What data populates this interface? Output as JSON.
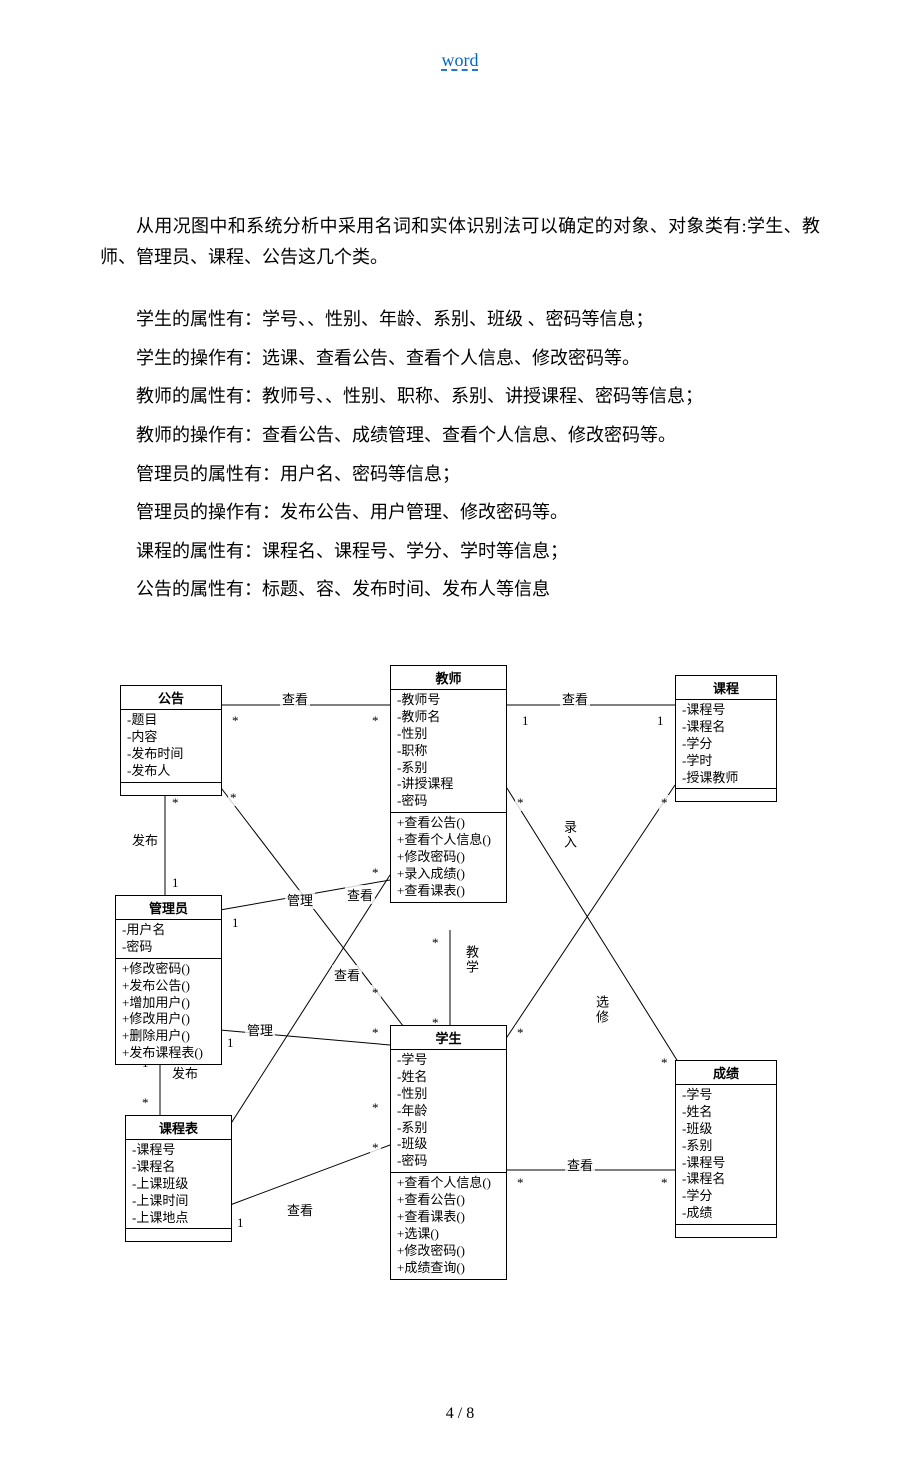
{
  "header": {
    "word_label": "word"
  },
  "paragraphs": {
    "intro": "从用况图中和系统分析中采用名词和实体识别法可以确定的对象、对象类有:学生、教师、管理员、课程、公告这几个类。",
    "lines": [
      "学生的属性有：学号、、性别、年龄、系别、班级 、密码等信息；",
      "学生的操作有：选课、查看公告、查看个人信息、修改密码等。",
      "教师的属性有：教师号、、性别、职称、系别、讲授课程、密码等信息；",
      "教师的操作有：查看公告、成绩管理、查看个人信息、修改密码等。",
      "管理员的属性有：用户名、密码等信息；",
      "管理员的操作有：发布公告、用户管理、修改密码等。",
      "课程的属性有：课程名、课程号、学分、学时等信息；",
      "公告的属性有：标题、容、发布时间、发布人等信息"
    ]
  },
  "diagram": {
    "boxes": {
      "gonggao": {
        "title": "公告",
        "attrs": [
          "-题目",
          "-内容",
          "-发布时间",
          "-发布人"
        ],
        "ops": []
      },
      "jiaoshi": {
        "title": "教师",
        "attrs": [
          "-教师号",
          "-教师名",
          "-性别",
          "-职称",
          "-系别",
          "-讲授课程",
          "-密码"
        ],
        "ops": [
          "+查看公告()",
          "+查看个人信息()",
          "+修改密码()",
          "+录入成绩()",
          "+查看课表()"
        ]
      },
      "kecheng": {
        "title": "课程",
        "attrs": [
          "-课程号",
          "-课程名",
          "-学分",
          "-学时",
          "-授课教师"
        ],
        "ops": []
      },
      "guanliyuan": {
        "title": "管理员",
        "attrs": [
          "-用户名",
          "-密码"
        ],
        "ops": [
          "+修改密码()",
          "+发布公告()",
          "+增加用户()",
          "+修改用户()",
          "+删除用户()",
          "+发布课程表()"
        ]
      },
      "xuesheng": {
        "title": "学生",
        "attrs": [
          "-学号",
          "-姓名",
          "-性别",
          "-年龄",
          "-系别",
          "-班级",
          "-密码"
        ],
        "ops": [
          "+查看个人信息()",
          "+查看公告()",
          "+查看课表()",
          "+选课()",
          "+修改密码()",
          "+成绩查询()"
        ]
      },
      "chengji": {
        "title": "成绩",
        "attrs": [
          "-学号",
          "-姓名",
          "-班级",
          "-系别",
          "-课程号",
          "-课程名",
          "-学分",
          "-成绩"
        ],
        "ops": []
      },
      "kechengbiao": {
        "title": "课程表",
        "attrs": [
          "-课程号",
          "-课程名",
          "-上课班级",
          "-上课时间",
          "-上课地点"
        ],
        "ops": []
      }
    },
    "edges": {
      "chakan1": "查看",
      "chakan2": "查看",
      "chakan3": "查看",
      "chakan4": "查看",
      "chakan5": "查看",
      "fabu1": "发布",
      "fabu2": "发布",
      "guanli1": "管理",
      "guanli2": "管理",
      "luru": "录入",
      "xuanxiu": "选修",
      "jiaoxue": "教学",
      "star": "*",
      "one": "1"
    }
  },
  "footer": {
    "pager": "4 / 8"
  }
}
